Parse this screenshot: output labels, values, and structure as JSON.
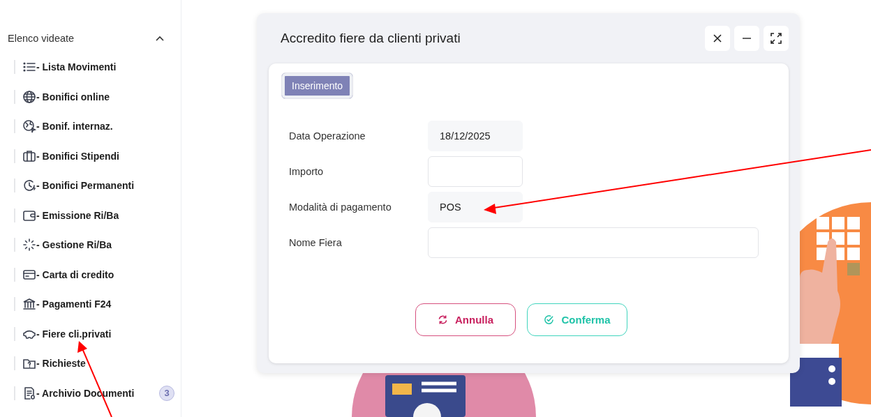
{
  "sidebar": {
    "title": "Elenco videate",
    "expanded": true,
    "items": [
      {
        "label": "- Lista Movimenti"
      },
      {
        "label": "- Bonifici online"
      },
      {
        "label": "- Bonif. internaz."
      },
      {
        "label": "- Bonifici Stipendi"
      },
      {
        "label": "- Bonifici Permanenti"
      },
      {
        "label": "- Emissione Ri/Ba"
      },
      {
        "label": "- Gestione Ri/Ba"
      },
      {
        "label": "- Carta di credito"
      },
      {
        "label": "- Pagamenti F24"
      },
      {
        "label": "- Fiere cli.privati"
      },
      {
        "label": "- Richieste"
      },
      {
        "label": "- Archivio Documenti",
        "badge": "3"
      }
    ]
  },
  "dialog": {
    "title": "Accredito fiere da clienti privati",
    "tabs": [
      {
        "label": "Inserimento",
        "selected": true
      }
    ],
    "fields": [
      {
        "label": "Data Operazione",
        "value": "18/12/2025",
        "readonly": true,
        "wide": false
      },
      {
        "label": "Importo",
        "readonly": false,
        "wide": false
      },
      {
        "label": "Modalità di pagamento",
        "value": "POS",
        "readonly": true,
        "wide": false
      },
      {
        "label": "Nome Fiera",
        "readonly": false,
        "wide": true
      }
    ],
    "buttons": [
      {
        "label": "Annulla",
        "kind": "cancel"
      },
      {
        "label": "Conferma",
        "kind": "confirm"
      }
    ]
  }
}
